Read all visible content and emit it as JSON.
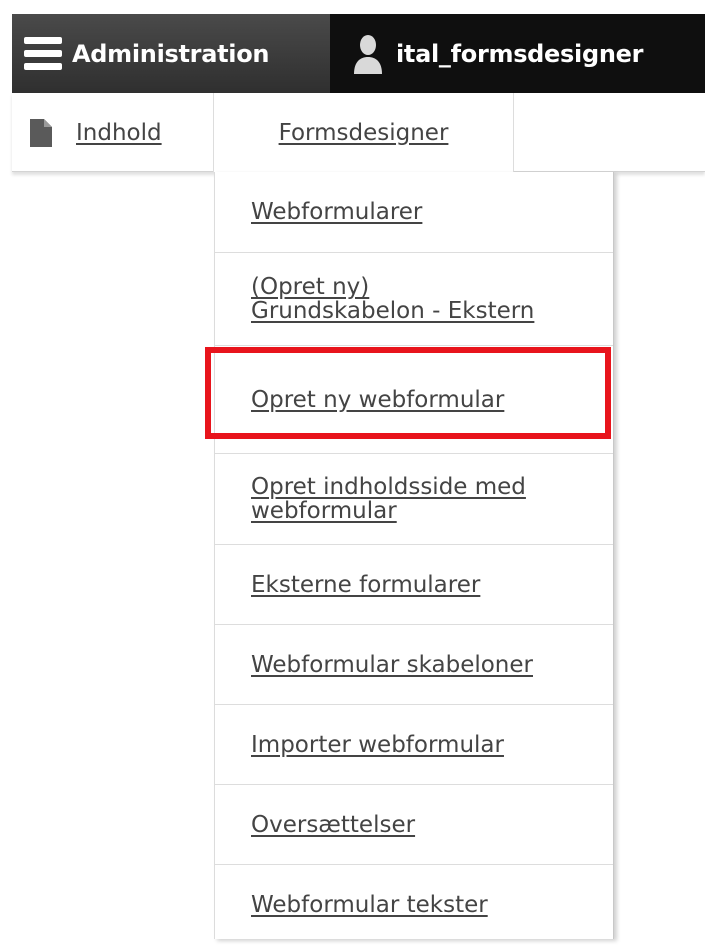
{
  "toolbar": {
    "admin_label": "Administration",
    "user_label": "ital_formsdesigner"
  },
  "tabs": {
    "content_label": "Indhold",
    "formsdesigner_label": "Formsdesigner"
  },
  "menu": {
    "items": [
      {
        "label": "Webformularer"
      },
      {
        "label": "(Opret ny)",
        "label2": "Grundskabelon - Ekstern"
      },
      {
        "label": "Opret ny webformular"
      },
      {
        "label": "Opret indholdsside med",
        "label2": "webformular"
      },
      {
        "label": "Eksterne formularer"
      },
      {
        "label": "Webformular skabeloner"
      },
      {
        "label": "Importer webformular"
      },
      {
        "label": "Oversættelser"
      },
      {
        "label": "Webformular tekster"
      }
    ]
  },
  "colors": {
    "toolbar_bg": "#0f0f0f",
    "highlight": "#e8141c",
    "link_text": "#444444"
  },
  "icons": {
    "menu": "hamburger-icon",
    "user": "user-icon",
    "content": "page-icon"
  }
}
